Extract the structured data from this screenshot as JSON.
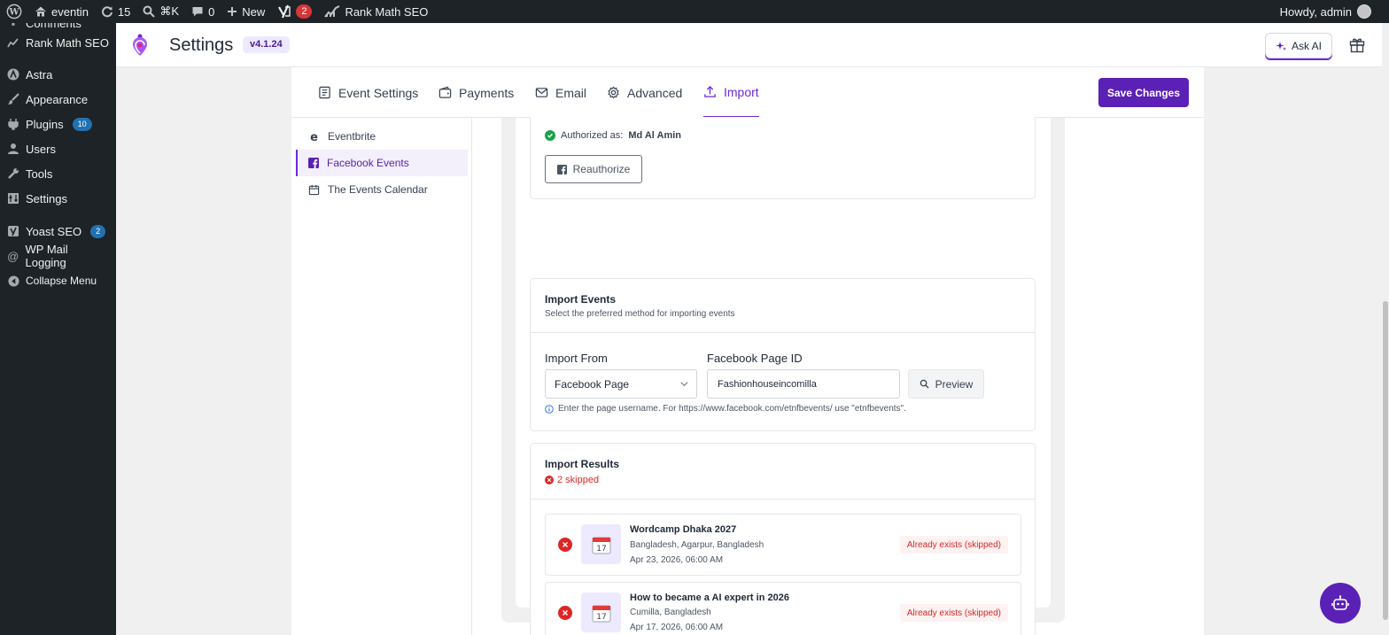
{
  "adminbar": {
    "site_name": "eventin",
    "updates_count": "15",
    "search_shortcut": "⌘K",
    "comments_count": "0",
    "new_label": "New",
    "yoast_count": "2",
    "rankmath_label": "Rank Math SEO",
    "howdy": "Howdy, admin"
  },
  "sidebar": {
    "items": [
      {
        "label": "Comments"
      },
      {
        "label": "Rank Math SEO"
      },
      {
        "label": "Astra"
      },
      {
        "label": "Appearance"
      },
      {
        "label": "Plugins",
        "badge": "10"
      },
      {
        "label": "Users"
      },
      {
        "label": "Tools"
      },
      {
        "label": "Settings"
      },
      {
        "label": "Yoast SEO",
        "badge": "2"
      },
      {
        "label": "WP Mail Logging"
      },
      {
        "label": "Collapse Menu"
      }
    ]
  },
  "header": {
    "title": "Settings",
    "version": "v4.1.24",
    "ask_ai": "Ask AI"
  },
  "tabs": [
    {
      "label": "Event Settings"
    },
    {
      "label": "Payments"
    },
    {
      "label": "Email"
    },
    {
      "label": "Advanced"
    },
    {
      "label": "Import"
    }
  ],
  "save_label": "Save Changes",
  "subnav": [
    {
      "label": "Eventbrite"
    },
    {
      "label": "Facebook Events"
    },
    {
      "label": "The Events Calendar"
    }
  ],
  "auth": {
    "prefix": "Authorized as:",
    "name": "Md Al Amin",
    "reauth_label": "Reauthorize"
  },
  "import_events": {
    "title": "Import Events",
    "subtitle": "Select the preferred method for importing events",
    "import_from_label": "Import From",
    "import_from_value": "Facebook Page",
    "page_id_label": "Facebook Page ID",
    "page_id_value": "Fashionhouseincomilla",
    "preview_label": "Preview",
    "help": "Enter the page username. For https://www.facebook.com/etnfbevents/ use \"etnfbevents\"."
  },
  "results": {
    "title": "Import Results",
    "skipped": "2 skipped",
    "items": [
      {
        "title": "Wordcamp Dhaka 2027",
        "location": "Bangladesh, Agarpur, Bangladesh",
        "date": "Apr 23, 2026, 06:00 AM",
        "status": "Already exists (skipped)",
        "day": "17"
      },
      {
        "title": "How to became a AI expert in 2026",
        "location": "Cumilla, Bangladesh",
        "date": "Apr 17, 2026, 06:00 AM",
        "status": "Already exists (skipped)",
        "day": "17"
      }
    ]
  },
  "colors": {
    "brand": "#5b21b6",
    "accent": "#6d28d9",
    "error": "#dc2626",
    "success": "#16a34a",
    "wp_dark": "#1d2327"
  }
}
